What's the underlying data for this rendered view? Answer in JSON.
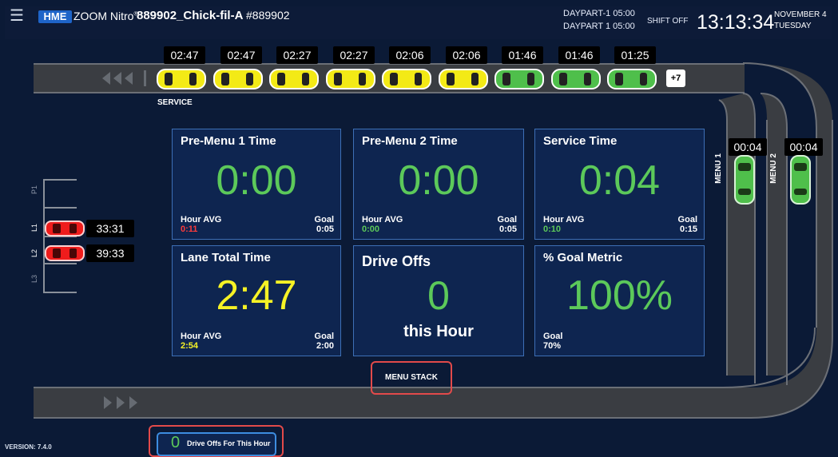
{
  "header": {
    "logo": "HME",
    "product": "ZOOM Nitro",
    "product_mark": "®",
    "store_name": "889902_Chick-fil-A",
    "store_number": "#889902",
    "daypart_1_label": "DAYPART-1",
    "daypart_1_time": "05:00",
    "daypart_2_label": "DAYPART 1",
    "daypart_2_time": "05:00",
    "shift": "SHIFT OFF",
    "clock": "13:13:34",
    "date_month_day": "NOVEMBER 4",
    "date_weekday": "TUESDAY"
  },
  "lane": {
    "service_label": "SERVICE",
    "queue_timers": [
      "02:47",
      "02:47",
      "02:27",
      "02:27",
      "02:06",
      "02:06",
      "01:46",
      "01:46",
      "01:25"
    ],
    "queue_car_colors": [
      "#f3ea16",
      "#f3ea16",
      "#f3ea16",
      "#f3ea16",
      "#f3ea16",
      "#f3ea16",
      "#4fbf4b",
      "#4fbf4b",
      "#4fbf4b"
    ],
    "more_count": "+7",
    "menu_1": {
      "label": "MENU 1",
      "timer": "00:04"
    },
    "menu_2": {
      "label": "MENU 2",
      "timer": "00:04"
    },
    "bays": [
      {
        "label": "P1",
        "timer": ""
      },
      {
        "label": "L1",
        "timer": "33:31"
      },
      {
        "label": "L2",
        "timer": "39:33"
      },
      {
        "label": "L3",
        "timer": ""
      }
    ]
  },
  "tiles": {
    "premenu1": {
      "title": "Pre-Menu 1 Time",
      "value": "0:00",
      "avg_label": "Hour AVG",
      "avg": "0:11",
      "goal_label": "Goal",
      "goal": "0:05"
    },
    "premenu2": {
      "title": "Pre-Menu 2 Time",
      "value": "0:00",
      "avg_label": "Hour AVG",
      "avg": "0:00",
      "goal_label": "Goal",
      "goal": "0:05"
    },
    "service": {
      "title": "Service Time",
      "value": "0:04",
      "avg_label": "Hour AVG",
      "avg": "0:10",
      "goal_label": "Goal",
      "goal": "0:15"
    },
    "lane_total": {
      "title": "Lane Total Time",
      "value": "2:47",
      "avg_label": "Hour AVG",
      "avg": "2:54",
      "goal_label": "Goal",
      "goal": "2:00"
    },
    "drive_offs": {
      "title": "Drive Offs",
      "value": "0",
      "sub": "this Hour"
    },
    "goal_metric": {
      "title": "% Goal Metric",
      "value": "100%",
      "goal_label": "Goal",
      "goal": "70%"
    }
  },
  "menu_stack_label": "MENU STACK",
  "drive_offs_footer": {
    "value": "0",
    "label": "Drive Offs For This Hour"
  },
  "version": "VERSION: 7.4.0",
  "colors": {
    "green": "#5cc95a",
    "yellow": "#f6f225",
    "red": "#ff3b3b",
    "background": "#0b1a36",
    "tile": "#0e2550"
  }
}
